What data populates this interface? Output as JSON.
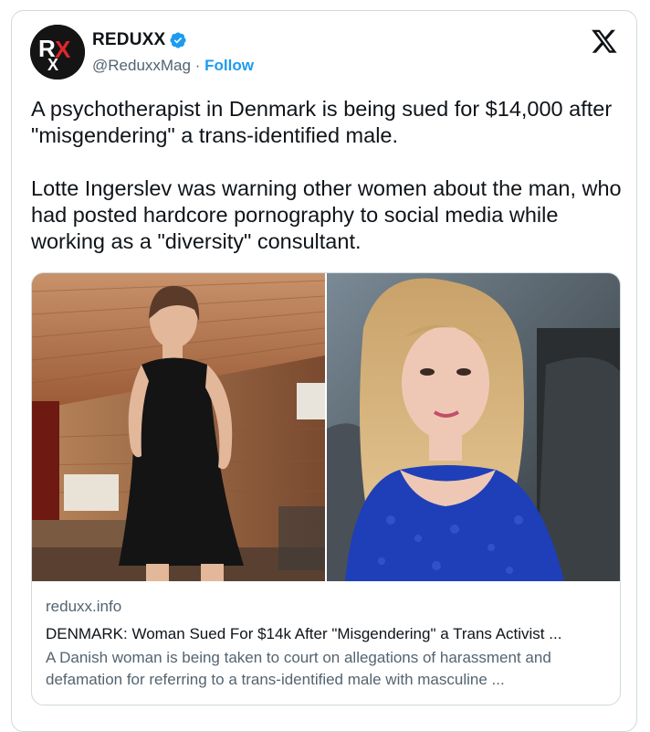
{
  "author": {
    "display_name": "REDUXX",
    "handle": "@ReduxxMag",
    "separator": "·",
    "follow_label": "Follow",
    "avatar_text": "RXX",
    "verified": true
  },
  "tweet": {
    "paragraphs": [
      "A psychotherapist in Denmark is being sued for $14,000 after \"misgendering\" a trans-identified male.",
      "Lotte Ingerslev was warning other women about the man, who had posted hardcore pornography to social media while working as a \"diversity\" consultant."
    ]
  },
  "link_card": {
    "domain": "reduxx.info",
    "headline": "DENMARK: Woman Sued For $14k After \"Misgendering\" a Trans Activist ...",
    "description": "A Danish woman is being taken to court on allegations of harassment and defamation for referring to a trans-identified male with masculine ..."
  },
  "colors": {
    "accent": "#1d9bf0",
    "text": "#0f1419",
    "muted": "#536471",
    "border": "#cfd9de"
  },
  "icons": [
    "verified-badge-icon",
    "x-logo-icon"
  ]
}
